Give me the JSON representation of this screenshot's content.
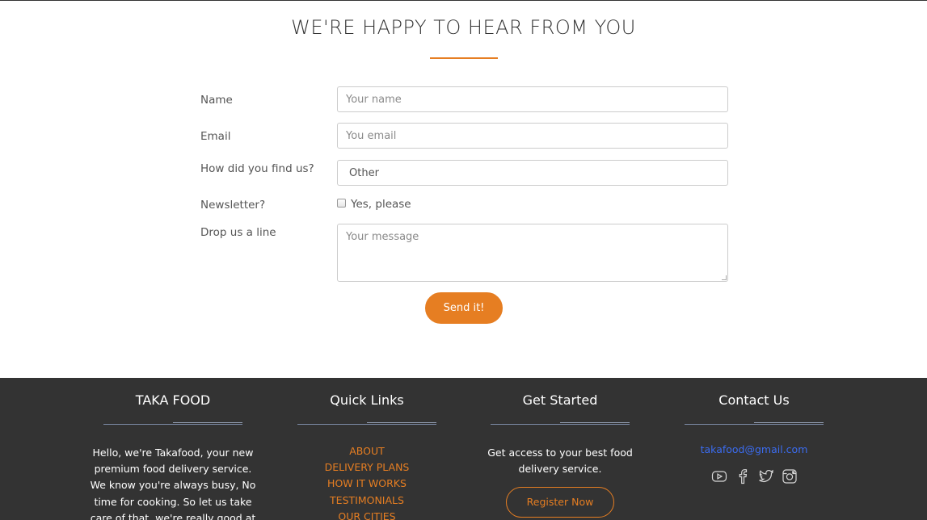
{
  "contact": {
    "title": "WE'RE HAPPY TO HEAR FROM YOU",
    "form": {
      "name_label": "Name",
      "name_placeholder": "Your name",
      "email_label": "Email",
      "email_placeholder": "You email",
      "find_label": "How did you find us?",
      "find_selected": "Other",
      "newsletter_label": "Newsletter?",
      "newsletter_option": "Yes, please",
      "message_label": "Drop us a line",
      "message_placeholder": "Your message",
      "submit_label": "Send it!"
    }
  },
  "footer": {
    "about": {
      "title": "TAKA FOOD",
      "text": "Hello, we're Takafood, your new premium food delivery service. We know you're always busy, No time for cooking. So let us take care of that, we're really good at it, we"
    },
    "quick_links": {
      "title": "Quick Links",
      "items": [
        "ABOUT",
        "DELIVERY PLANS",
        "HOW IT WORKS",
        "TESTIMONIALS",
        "OUR CITIES"
      ]
    },
    "get_started": {
      "title": "Get Started",
      "text": "Get access to your best food delivery service.",
      "button": "Register Now"
    },
    "contact_us": {
      "title": "Contact Us",
      "email": "takafood@gmail.com",
      "icons": [
        "youtube-icon",
        "facebook-icon",
        "twitter-icon",
        "instagram-icon"
      ]
    }
  },
  "colors": {
    "accent": "#e67e22",
    "footer_bg": "#333333",
    "link_blue": "#3b6cf0"
  }
}
